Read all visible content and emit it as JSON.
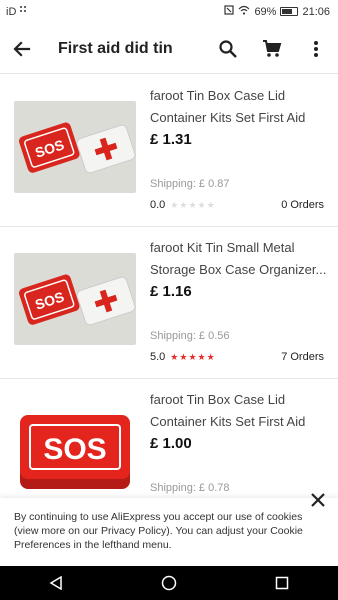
{
  "status_bar": {
    "carrier": "iD",
    "battery": "69%",
    "time": "21:06"
  },
  "app_bar": {
    "title": "First aid did tin"
  },
  "products": [
    {
      "title": "faroot Tin Box Case Lid Container Kits Set First Aid",
      "price": "£ 1.31",
      "shipping": "Shipping: £ 0.87",
      "rating": "0.0",
      "stars_filled": 0,
      "orders": "0 Orders",
      "image": "sos-and-cross-tins"
    },
    {
      "title": "faroot Kit Tin Small Metal Storage Box Case Organizer...",
      "price": "£ 1.16",
      "shipping": "Shipping: £ 0.56",
      "rating": "5.0",
      "stars_filled": 5,
      "orders": "7 Orders",
      "image": "sos-and-cross-tins"
    },
    {
      "title": "faroot Tin Box Case Lid Container Kits Set First Aid",
      "price": "£ 1.00",
      "shipping": "Shipping: £ 0.78",
      "rating": "",
      "stars_filled": 0,
      "orders": "",
      "image": "sos-red-tin"
    }
  ],
  "cookie_banner": {
    "text": "By continuing to use AliExpress you accept our use of cookies (view more on our Privacy Policy). You can adjust your Cookie Preferences in the lefthand menu."
  },
  "colors": {
    "accent_red": "#e62e2e",
    "text_dark": "#222222",
    "text_muted": "#999999"
  }
}
